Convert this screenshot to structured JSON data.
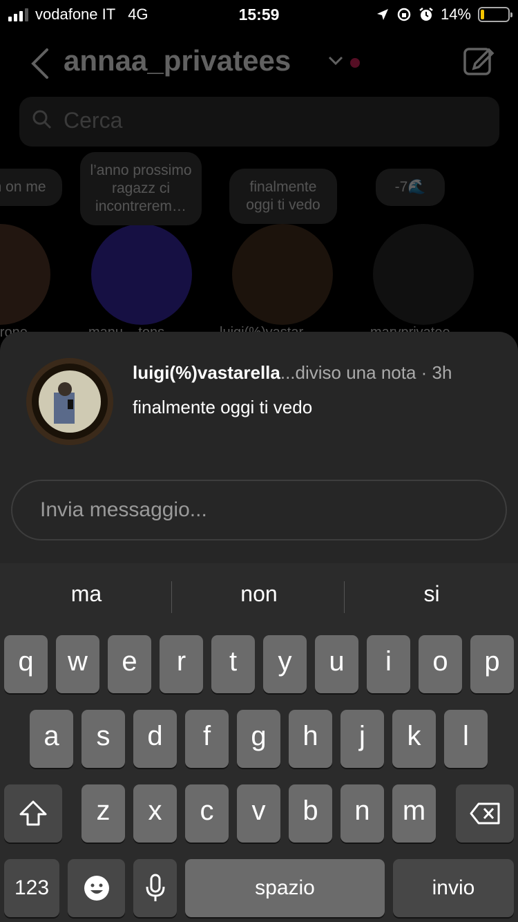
{
  "status_bar": {
    "carrier": "vodafone IT",
    "network": "4G",
    "time": "15:59",
    "battery_percent": "14%",
    "battery_level": 0.14
  },
  "header": {
    "username": "annaa_privatees"
  },
  "search": {
    "placeholder": "Cerca"
  },
  "notes": [
    {
      "text": "stare in on me",
      "name": "errone"
    },
    {
      "text": "l’anno prossimo ragazz ci incontrerem…",
      "name": "manu__tons"
    },
    {
      "text": "finalmente oggi ti vedo",
      "name": "luigi(%)vastar"
    },
    {
      "text": "-7🌊",
      "name": "marvprivatee"
    }
  ],
  "sheet": {
    "author": "luigi(%)vastarella",
    "meta": "...diviso una nota · 3h",
    "note_text": "finalmente oggi ti vedo",
    "message_placeholder": "Invia messaggio..."
  },
  "keyboard": {
    "suggestions": [
      "ma",
      "non",
      "si"
    ],
    "row1": [
      "q",
      "w",
      "e",
      "r",
      "t",
      "y",
      "u",
      "i",
      "o",
      "p"
    ],
    "row2": [
      "a",
      "s",
      "d",
      "f",
      "g",
      "h",
      "j",
      "k",
      "l"
    ],
    "row3": [
      "z",
      "x",
      "c",
      "v",
      "b",
      "n",
      "m"
    ],
    "numbers_key": "123",
    "space_key": "spazio",
    "return_key": "invio"
  },
  "colors": {
    "accent_dot": "#e0245e",
    "battery": "#f5c400",
    "sheet_bg": "#262626",
    "keyboard_bg": "#2b2b2b"
  }
}
